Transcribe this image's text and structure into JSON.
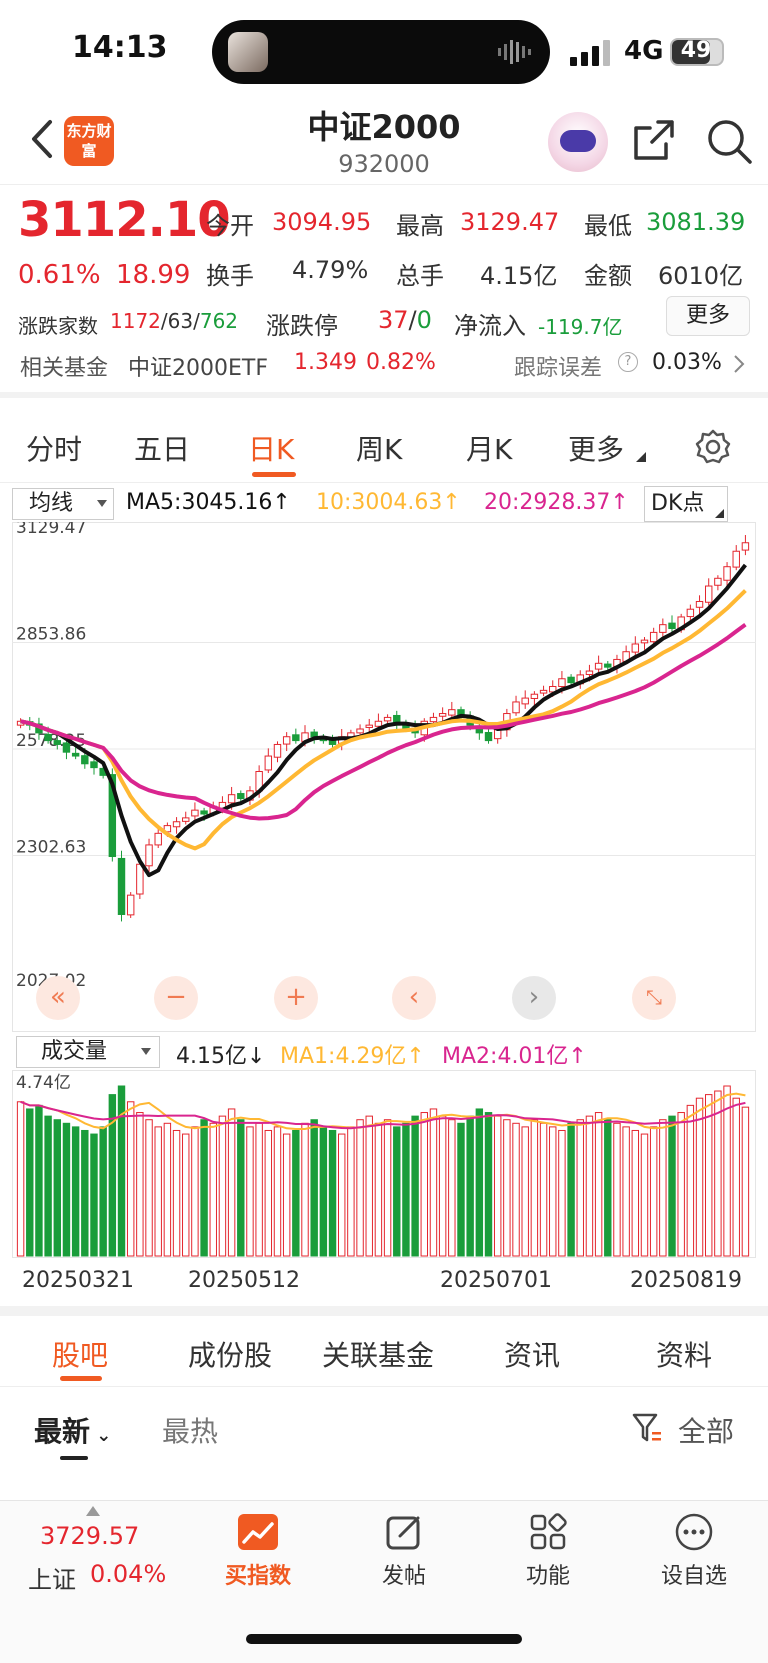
{
  "status": {
    "time": "14:13",
    "network": "4G",
    "battery": "49"
  },
  "header": {
    "title": "中证2000",
    "code": "932000",
    "logo": "东方财富"
  },
  "quote": {
    "price": "3112.10",
    "change_pct": "0.61%",
    "change": "18.99",
    "open_label": "今开",
    "open": "3094.95",
    "high_label": "最高",
    "high": "3129.47",
    "low_label": "最低",
    "low": "3081.39",
    "turnover_label": "换手",
    "turnover": "4.79%",
    "volume_label": "总手",
    "volume": "4.15亿",
    "amount_label": "金额",
    "amount": "6010亿",
    "breadth_label": "涨跌家数",
    "breadth_up": "1172",
    "breadth_flat": "63",
    "breadth_down": "762",
    "limit_label": "涨跌停",
    "limit_up": "37",
    "limit_down": "0",
    "netflow_label": "净流入",
    "netflow": "-119.7亿",
    "more": "更多"
  },
  "fund_row": {
    "label": "相关基金",
    "name": "中证2000ETF",
    "price": "1.349",
    "pct": "0.82%",
    "track_label": "跟踪误差",
    "track_value": "0.03%"
  },
  "ktabs": [
    {
      "label": "分时"
    },
    {
      "label": "五日"
    },
    {
      "label": "日K"
    },
    {
      "label": "周K"
    },
    {
      "label": "月K"
    },
    {
      "label": "更多"
    }
  ],
  "ma": {
    "select": "均线",
    "ma5": "MA5:3045.16↑",
    "ma10": "10:3004.63↑",
    "ma20": "20:2928.37↑",
    "dk": "DK点"
  },
  "colors": {
    "accent": "#f05a22",
    "up": "#e4262e",
    "down": "#1a9d3b",
    "ma5": "#111111",
    "ma10": "#ffb833",
    "ma20": "#d9258f"
  },
  "chart_data": {
    "type": "candlestick",
    "ylim": [
      2027.02,
      3129.47
    ],
    "y_ticks": [
      "3129.47",
      "2853.86",
      "2578.25",
      "2302.63",
      "2027.02"
    ],
    "x_labels": [
      "20250321",
      "20250512",
      "20250701",
      "20250819"
    ],
    "closes": [
      2650,
      2640,
      2620,
      2600,
      2590,
      2570,
      2560,
      2540,
      2530,
      2510,
      2300,
      2150,
      2200,
      2280,
      2330,
      2360,
      2380,
      2390,
      2400,
      2420,
      2410,
      2430,
      2440,
      2460,
      2450,
      2470,
      2520,
      2560,
      2590,
      2610,
      2600,
      2620,
      2610,
      2600,
      2590,
      2610,
      2620,
      2630,
      2640,
      2650,
      2660,
      2640,
      2630,
      2620,
      2650,
      2660,
      2670,
      2680,
      2660,
      2640,
      2620,
      2600,
      2630,
      2670,
      2700,
      2710,
      2720,
      2730,
      2740,
      2760,
      2750,
      2770,
      2780,
      2800,
      2790,
      2810,
      2830,
      2850,
      2860,
      2880,
      2900,
      2890,
      2920,
      2940,
      2960,
      3000,
      3020,
      3050,
      3090,
      3112
    ],
    "volume": {
      "values": [
        4.3,
        4.1,
        4.2,
        3.9,
        3.8,
        3.7,
        3.6,
        3.5,
        3.4,
        3.6,
        4.5,
        4.74,
        4.3,
        4.0,
        3.8,
        3.6,
        3.7,
        3.5,
        3.4,
        3.6,
        3.8,
        3.7,
        3.9,
        4.1,
        3.8,
        3.6,
        3.7,
        3.5,
        3.6,
        3.4,
        3.5,
        3.7,
        3.8,
        3.6,
        3.5,
        3.4,
        3.6,
        3.8,
        3.9,
        3.7,
        3.8,
        3.6,
        3.7,
        3.9,
        4.0,
        4.1,
        3.9,
        3.8,
        3.7,
        3.9,
        4.1,
        4.0,
        3.9,
        3.8,
        3.7,
        3.6,
        3.8,
        3.7,
        3.6,
        3.5,
        3.7,
        3.8,
        3.9,
        4.0,
        3.8,
        3.7,
        3.6,
        3.5,
        3.4,
        3.6,
        3.8,
        3.9,
        4.0,
        4.2,
        4.4,
        4.5,
        4.6,
        4.74,
        4.4,
        4.15
      ],
      "ylabel_top": "4.74亿"
    }
  },
  "volume_row": {
    "select": "成交量",
    "val": "4.15亿↓",
    "ma1": "MA1:4.29亿↑",
    "ma2": "MA2:4.01亿↑"
  },
  "btabs": [
    {
      "label": "股吧"
    },
    {
      "label": "成份股"
    },
    {
      "label": "关联基金"
    },
    {
      "label": "资讯"
    },
    {
      "label": "资料"
    }
  ],
  "sort": {
    "latest": "最新",
    "hot": "最热",
    "filter": "全部"
  },
  "bottom_nav": {
    "ticker_value": "3729.57",
    "ticker_name": "上证",
    "ticker_pct": "0.04%",
    "items": [
      {
        "label": "买指数"
      },
      {
        "label": "发帖"
      },
      {
        "label": "功能"
      },
      {
        "label": "设自选"
      }
    ]
  }
}
